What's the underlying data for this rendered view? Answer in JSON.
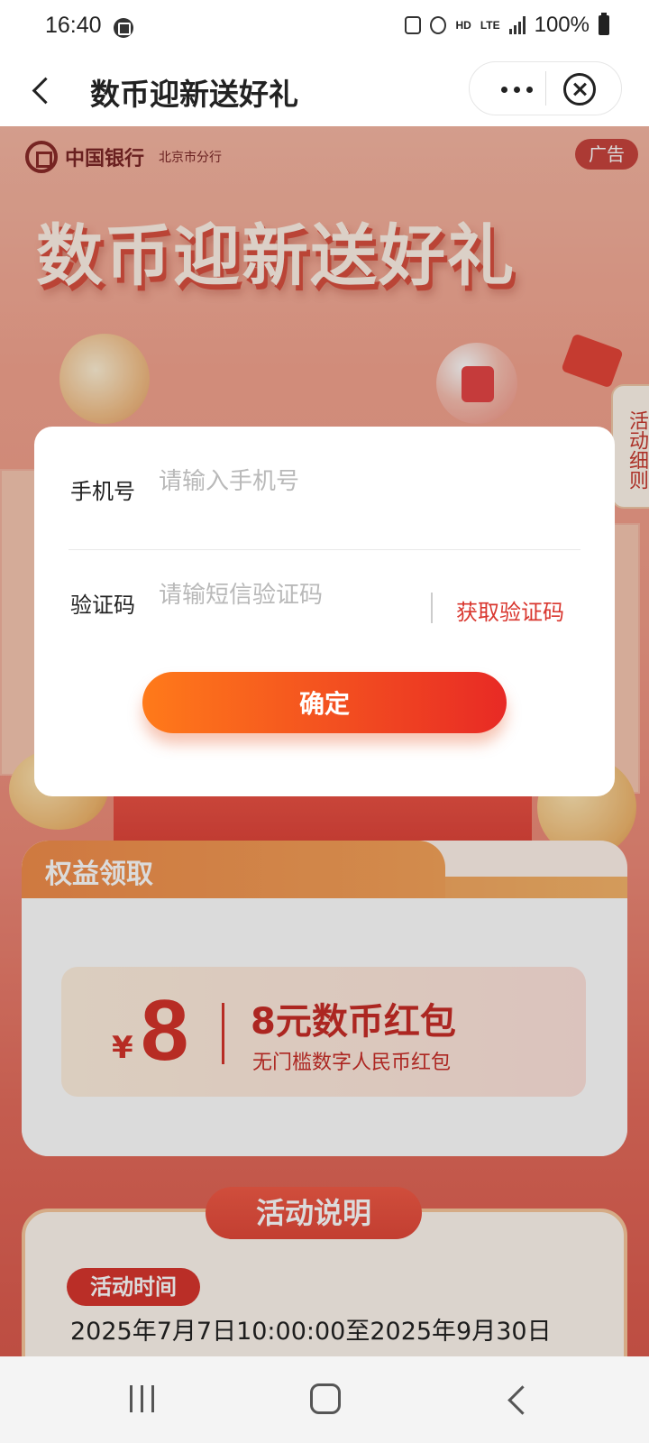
{
  "status_bar": {
    "time": "16:40",
    "network": "LTE",
    "hd": "HD",
    "battery": "100%"
  },
  "nav": {
    "title": "数币迎新送好礼"
  },
  "banner": {
    "bank_name": "中国银行",
    "branch": "北京市分行",
    "ad_badge": "广告",
    "hero_title": "数币迎新送好礼",
    "side_tab": "活动细则"
  },
  "rights": {
    "title": "权益领取",
    "coupon": {
      "currency": "¥",
      "amount": "8",
      "name": "8元数币红包",
      "desc": "无门槛数字人民币红包"
    }
  },
  "description": {
    "title": "活动说明",
    "time_label": "活动时间",
    "time_text": "2025年7月7日10:00:00至2025年9月30日"
  },
  "modal": {
    "phone_label": "手机号",
    "phone_placeholder": "请输入手机号",
    "code_label": "验证码",
    "code_placeholder": "请输短信验证码",
    "get_code": "获取验证码",
    "confirm": "确定"
  },
  "colors": {
    "accent_red": "#d9362e",
    "button_gradient_start": "#ff7a1a",
    "button_gradient_end": "#e82a25"
  }
}
